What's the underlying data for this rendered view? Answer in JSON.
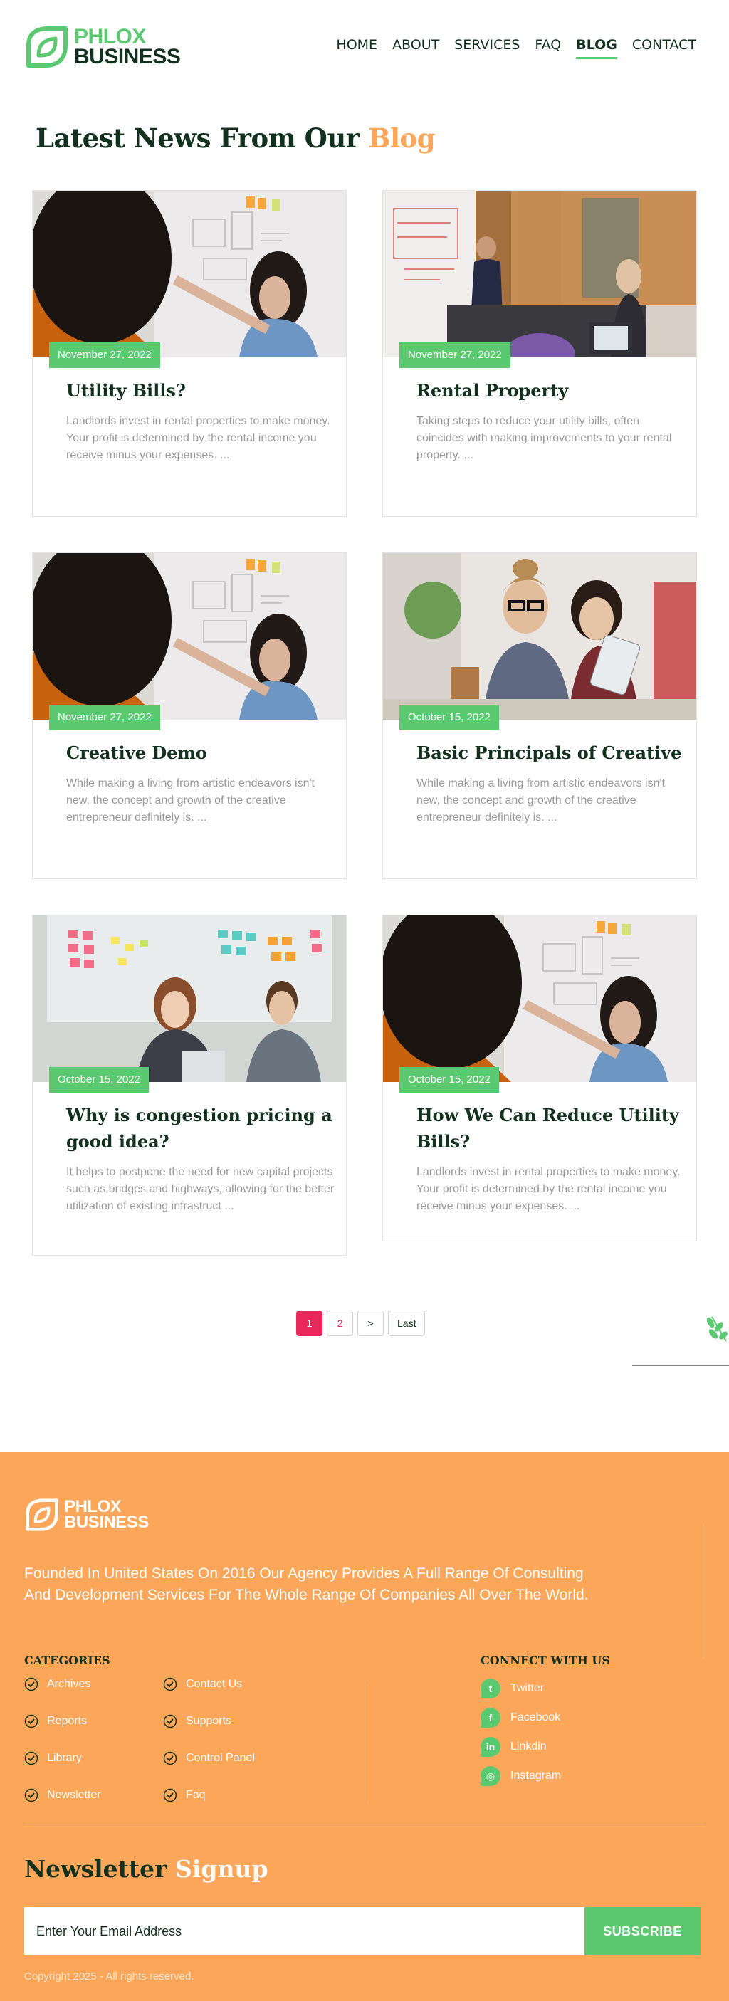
{
  "brand": {
    "line1": "PHLOX",
    "line2": "BUSINESS"
  },
  "nav": [
    {
      "label": "HOME",
      "active": false
    },
    {
      "label": "ABOUT",
      "active": false
    },
    {
      "label": "SERVICES",
      "active": false
    },
    {
      "label": "FAQ",
      "active": false
    },
    {
      "label": "BLOG",
      "active": true
    },
    {
      "label": "CONTACT",
      "active": false
    }
  ],
  "heading": {
    "main": "Latest News From Our ",
    "accent": "Blog"
  },
  "posts": [
    {
      "date": "November 27, 2022",
      "title": "Utility Bills?",
      "excerpt": "Landlords invest in rental properties to make money. Your profit is determined by the rental income you receive minus your expenses. ..."
    },
    {
      "date": "November 27, 2022",
      "title": "Rental Property",
      "excerpt": "Taking steps to reduce your utility bills, often coincides with making improvements to your rental property. ..."
    },
    {
      "date": "November 27, 2022",
      "title": "Creative Demo",
      "excerpt": "While making a living from artistic endeavors isn't new, the concept and growth of the creative entrepreneur definitely is. ..."
    },
    {
      "date": "October 15, 2022",
      "title": "Basic Principals of Creative",
      "excerpt": "While making a living from artistic endeavors isn't new, the concept and growth of the creative entrepreneur definitely is. ..."
    },
    {
      "date": "October 15, 2022",
      "title": "Why is congestion pricing a good idea?",
      "excerpt": "It helps to postpone the need for new capital projects such as bridges and highways, allowing for the better utilization of existing infrastruct ..."
    },
    {
      "date": "October 15, 2022",
      "title": "How We Can Reduce Utility Bills?",
      "excerpt": "Landlords invest in rental properties to make money. Your profit is determined by the rental income you receive minus your expenses. ..."
    }
  ],
  "pagination": {
    "page1": "1",
    "page2": "2",
    "next": ">",
    "last": "Last"
  },
  "footer": {
    "about": "Founded In United States On 2016 Our Agency Provides A Full Range Of Consulting And Development Services For The Whole Range Of Companies All Over The World.",
    "categories_title": "CATEGORIES",
    "categories": [
      "Archives",
      "Contact Us",
      "Reports",
      "Supports",
      "Library",
      "Control Panel",
      "Newsletter",
      "Faq"
    ],
    "connect_title": "CONNECT WITH US",
    "social": [
      {
        "label": "Twitter",
        "icon": "twitter-icon"
      },
      {
        "label": "Facebook",
        "icon": "facebook-icon"
      },
      {
        "label": "Linkdin",
        "icon": "linkedin-icon"
      },
      {
        "label": "Instagram",
        "icon": "instagram-icon"
      }
    ],
    "newsletter_main": "Newsletter ",
    "newsletter_accent": "Signup",
    "email_placeholder": "Enter Your Email Address",
    "subscribe": "SUBSCRIBE",
    "copyright": "Copyright 2025 - All rights reserved."
  },
  "colors": {
    "green": "#5bc970",
    "orange": "#fca65a",
    "dark": "#12311f",
    "pink": "#e8275a"
  }
}
